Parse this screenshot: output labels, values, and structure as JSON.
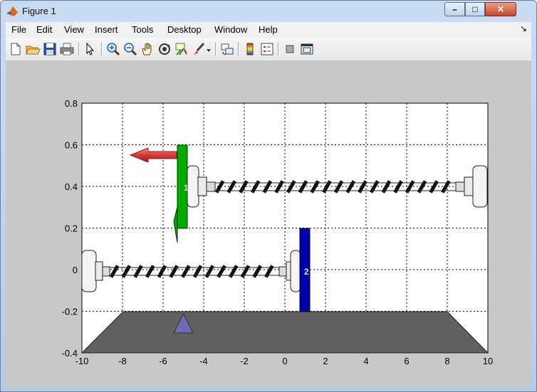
{
  "window": {
    "title": "Figure 1",
    "controls": [
      "minimize",
      "maximize",
      "close"
    ]
  },
  "menu": [
    "File",
    "Edit",
    "View",
    "Insert",
    "Tools",
    "Desktop",
    "Window",
    "Help"
  ],
  "toolbar": {
    "icons": [
      "new-figure-icon",
      "open-file-icon",
      "save-icon",
      "print-icon",
      "pointer-icon",
      "zoom-in-icon",
      "zoom-out-icon",
      "pan-icon",
      "rotate-3d-icon",
      "data-cursor-icon",
      "brush-icon",
      "brush-dropdown-icon",
      "link-plot-icon",
      "colorbar-icon",
      "legend-icon",
      "hide-plot-tools-icon",
      "show-plot-tools-icon"
    ]
  },
  "plot": {
    "xlim": [
      -10,
      10
    ],
    "ylim": [
      -0.4,
      0.8
    ],
    "xticks": [
      "-10",
      "-8",
      "-6",
      "-4",
      "-2",
      "0",
      "2",
      "4",
      "6",
      "8",
      "10"
    ],
    "yticks": [
      "0.8",
      "0.6",
      "0.4",
      "0.2",
      "0",
      "-0.2",
      "-0.4"
    ],
    "grid": true,
    "labels": {
      "body1": "1",
      "body2": "2"
    },
    "colors": {
      "body1": "#00aa00",
      "body2": "#0000aa",
      "ground": "#606060",
      "arrow": "#d63a3a",
      "marker": "#6b6bb8"
    }
  }
}
